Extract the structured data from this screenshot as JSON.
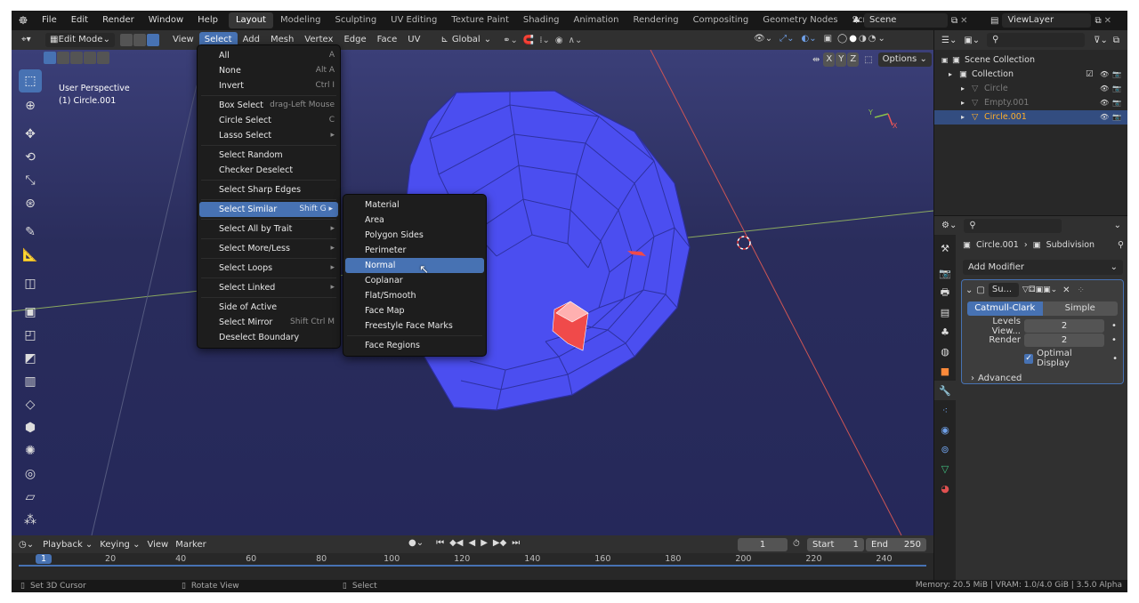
{
  "topbar": {
    "menus": [
      "File",
      "Edit",
      "Render",
      "Window",
      "Help"
    ],
    "workspaces": [
      "Layout",
      "Modeling",
      "Sculpting",
      "UV Editing",
      "Texture Paint",
      "Shading",
      "Animation",
      "Rendering",
      "Compositing",
      "Geometry Nodes",
      "Scripting"
    ],
    "active_workspace": "Layout",
    "add_tab": "+",
    "scene": "Scene",
    "view_layer": "ViewLayer"
  },
  "header": {
    "mode": "Edit Mode",
    "menus": [
      "View",
      "Select",
      "Add",
      "Mesh",
      "Vertex",
      "Edge",
      "Face",
      "UV"
    ],
    "active_menu": "Select",
    "orientation": "Global",
    "options": "Options",
    "axes": [
      "X",
      "Y",
      "Z"
    ]
  },
  "viewport": {
    "title": "User Perspective",
    "object": "(1) Circle.001",
    "gizmo": {
      "x": "X",
      "y": "Y"
    }
  },
  "select_menu": {
    "items": [
      {
        "label": "All",
        "shortcut": "A"
      },
      {
        "label": "None",
        "shortcut": "Alt A"
      },
      {
        "label": "Invert",
        "shortcut": "Ctrl I"
      },
      {
        "sep": true
      },
      {
        "label": "Box Select",
        "shortcut": "drag-Left Mouse"
      },
      {
        "label": "Circle Select",
        "shortcut": "C"
      },
      {
        "label": "Lasso Select",
        "shortcut": "▸"
      },
      {
        "sep": true
      },
      {
        "label": "Select Random",
        "shortcut": ""
      },
      {
        "label": "Checker Deselect",
        "shortcut": ""
      },
      {
        "sep": true
      },
      {
        "label": "Select Sharp Edges",
        "shortcut": ""
      },
      {
        "sep": true
      },
      {
        "label": "Select Similar",
        "shortcut": "Shift G ▸",
        "hl": true
      },
      {
        "sep": true
      },
      {
        "label": "Select All by Trait",
        "shortcut": "▸"
      },
      {
        "sep": true
      },
      {
        "label": "Select More/Less",
        "shortcut": "▸"
      },
      {
        "sep": true
      },
      {
        "label": "Select Loops",
        "shortcut": "▸"
      },
      {
        "sep": true
      },
      {
        "label": "Select Linked",
        "shortcut": "▸"
      },
      {
        "sep": true
      },
      {
        "label": "Side of Active",
        "shortcut": ""
      },
      {
        "label": "Select Mirror",
        "shortcut": "Shift Ctrl M"
      },
      {
        "label": "Deselect Boundary",
        "shortcut": ""
      }
    ]
  },
  "similar_menu": {
    "items": [
      {
        "label": "Material"
      },
      {
        "label": "Area"
      },
      {
        "label": "Polygon Sides"
      },
      {
        "label": "Perimeter"
      },
      {
        "label": "Normal",
        "hl": true
      },
      {
        "label": "Coplanar"
      },
      {
        "label": "Flat/Smooth"
      },
      {
        "label": "Face Map"
      },
      {
        "label": "Freestyle Face Marks"
      },
      {
        "sep": true
      },
      {
        "label": "Face Regions"
      }
    ]
  },
  "timeline": {
    "menus": [
      "Playback",
      "Keying",
      "View",
      "Marker"
    ],
    "current_frame": "1",
    "start_label": "Start",
    "start": "1",
    "end_label": "End",
    "end": "250",
    "ticks": [
      "1",
      "20",
      "40",
      "60",
      "80",
      "100",
      "120",
      "140",
      "160",
      "180",
      "200",
      "220",
      "240"
    ],
    "tick_values": [
      1,
      20,
      40,
      60,
      80,
      100,
      120,
      140,
      160,
      180,
      200,
      220,
      240
    ],
    "frame_start": 1,
    "frame_end": 250
  },
  "status": {
    "hints": [
      "Set 3D Cursor",
      "Rotate View",
      "Select"
    ],
    "info": "Memory: 20.5 MiB | VRAM: 1.0/4.0 GiB | 3.5.0 Alpha"
  },
  "outliner": {
    "items": [
      {
        "label": "Scene Collection",
        "level": 0
      },
      {
        "label": "Collection",
        "level": 1
      },
      {
        "label": "Circle",
        "level": 2,
        "color": "#7a7a7a"
      },
      {
        "label": "Empty.001",
        "level": 2,
        "color": "#7a7a7a"
      },
      {
        "label": "Circle.001",
        "level": 2,
        "color": "#ffaf29",
        "selected": true
      }
    ]
  },
  "properties": {
    "breadcrumb": [
      "Circle.001",
      "Subdivision"
    ],
    "add_modifier": "Add Modifier",
    "modifier_name": "Su...",
    "tabs": [
      "Catmull-Clark",
      "Simple"
    ],
    "active_tab": "Catmull-Clark",
    "fields": [
      {
        "label": "Levels View...",
        "value": "2"
      },
      {
        "label": "Render",
        "value": "2"
      }
    ],
    "optimal_display": "Optimal Display",
    "advanced": "Advanced"
  },
  "colors": {
    "accent": "#4772b3",
    "mesh": "#4b4ef0",
    "selected_face": "#f04a4a",
    "object_orange": "#ffaf29"
  }
}
